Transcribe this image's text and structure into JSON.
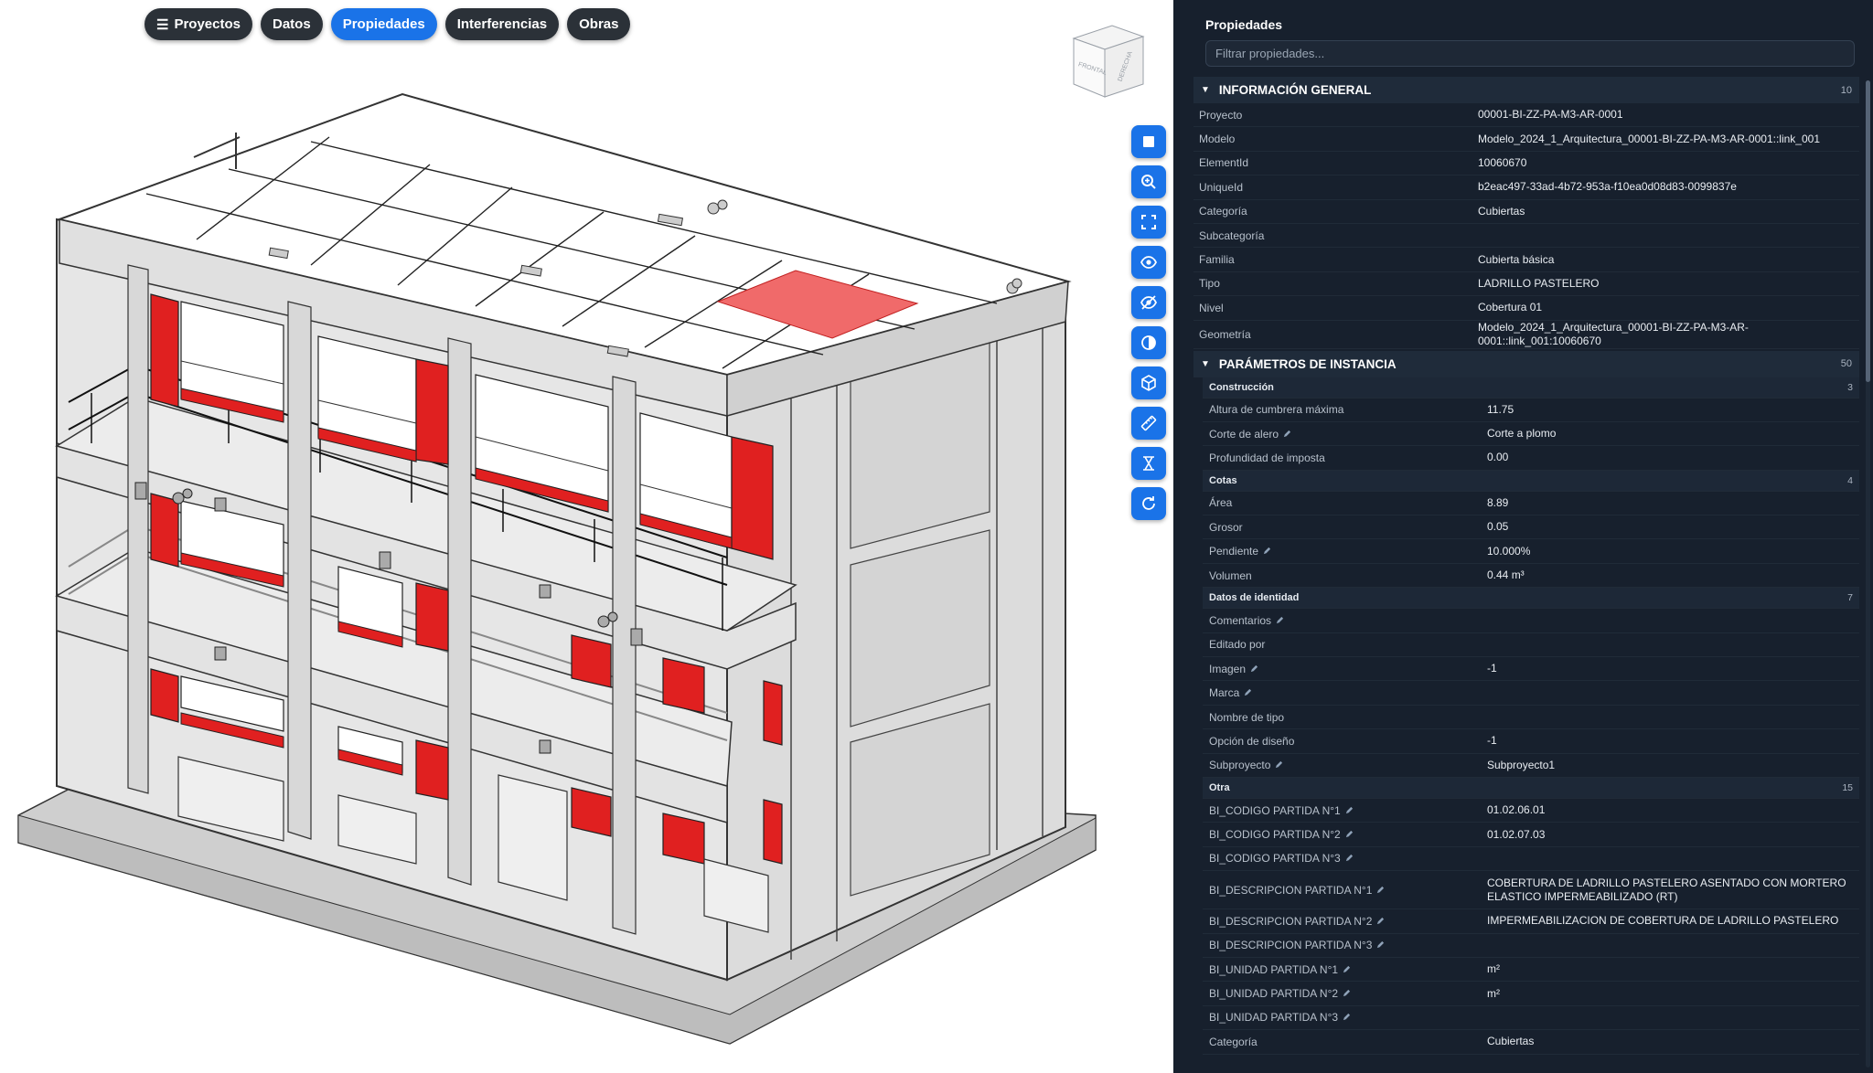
{
  "nav": {
    "items": [
      {
        "label": "Proyectos",
        "active": false,
        "icon": "menu-icon"
      },
      {
        "label": "Datos",
        "active": false
      },
      {
        "label": "Propiedades",
        "active": true
      },
      {
        "label": "Interferencias",
        "active": false
      },
      {
        "label": "Obras",
        "active": false
      }
    ]
  },
  "viewcube": {
    "front_label": "FRONTAL",
    "right_label": "DERECHA"
  },
  "toolbar": {
    "buttons": [
      {
        "icon": "square-view-icon"
      },
      {
        "icon": "zoom-icon"
      },
      {
        "icon": "fit-view-icon"
      },
      {
        "icon": "show-icon"
      },
      {
        "icon": "hide-icon"
      },
      {
        "icon": "contrast-icon"
      },
      {
        "icon": "cube-icon"
      },
      {
        "icon": "measure-icon"
      },
      {
        "icon": "section-icon"
      },
      {
        "icon": "reset-icon"
      }
    ]
  },
  "colors": {
    "accent": "#1a73e8",
    "panel_bg": "#17202d",
    "highlight": "#e02020"
  },
  "panel": {
    "title": "Propiedades",
    "filter_placeholder": "Filtrar propiedades...",
    "general": {
      "title": "INFORMACIÓN GENERAL",
      "count": "10",
      "rows": [
        {
          "k": "Proyecto",
          "v": "00001-BI-ZZ-PA-M3-AR-0001"
        },
        {
          "k": "Modelo",
          "v": "Modelo_2024_1_Arquitectura_00001-BI-ZZ-PA-M3-AR-0001::link_001"
        },
        {
          "k": "ElementId",
          "v": "10060670"
        },
        {
          "k": "UniqueId",
          "v": "b2eac497-33ad-4b72-953a-f10ea0d08d83-0099837e"
        },
        {
          "k": "Categoría",
          "v": "Cubiertas"
        },
        {
          "k": "Subcategoría",
          "v": ""
        },
        {
          "k": "Familia",
          "v": "Cubierta básica"
        },
        {
          "k": "Tipo",
          "v": "LADRILLO PASTELERO"
        },
        {
          "k": "Nivel",
          "v": "Cobertura 01"
        },
        {
          "k": "Geometría",
          "v": "Modelo_2024_1_Arquitectura_00001-BI-ZZ-PA-M3-AR-0001::link_001:10060670"
        }
      ]
    },
    "instance": {
      "title": "PARÁMETROS DE INSTANCIA",
      "count": "50",
      "groups": [
        {
          "title": "Construcción",
          "count": "3",
          "rows": [
            {
              "k": "Altura de cumbrera máxima",
              "v": "11.75",
              "edit": false
            },
            {
              "k": "Corte de alero",
              "v": "Corte a plomo",
              "edit": true
            },
            {
              "k": "Profundidad de imposta",
              "v": "0.00",
              "edit": false
            }
          ]
        },
        {
          "title": "Cotas",
          "count": "4",
          "rows": [
            {
              "k": "Área",
              "v": "8.89",
              "edit": false
            },
            {
              "k": "Grosor",
              "v": "0.05",
              "edit": false
            },
            {
              "k": "Pendiente",
              "v": "10.000%",
              "edit": true
            },
            {
              "k": "Volumen",
              "v": "0.44 m³",
              "edit": false
            }
          ]
        },
        {
          "title": "Datos de identidad",
          "count": "7",
          "rows": [
            {
              "k": "Comentarios",
              "v": "",
              "edit": true
            },
            {
              "k": "Editado por",
              "v": "",
              "edit": false
            },
            {
              "k": "Imagen",
              "v": "-1",
              "edit": true
            },
            {
              "k": "Marca",
              "v": "",
              "edit": true
            },
            {
              "k": "Nombre de tipo",
              "v": "",
              "edit": false
            },
            {
              "k": "Opción de diseño",
              "v": "-1",
              "edit": false
            },
            {
              "k": "Subproyecto",
              "v": "Subproyecto1",
              "edit": true
            }
          ]
        },
        {
          "title": "Otra",
          "count": "15",
          "rows": [
            {
              "k": "BI_CODIGO PARTIDA N°1",
              "v": "01.02.06.01",
              "edit": true
            },
            {
              "k": "BI_CODIGO PARTIDA N°2",
              "v": "01.02.07.03",
              "edit": true
            },
            {
              "k": "BI_CODIGO PARTIDA N°3",
              "v": "",
              "edit": true
            },
            {
              "k": "BI_DESCRIPCION PARTIDA N°1",
              "v": "COBERTURA DE LADRILLO PASTELERO ASENTADO CON MORTERO ELASTICO IMPERMEABILIZADO (RT)",
              "edit": true,
              "tall": true
            },
            {
              "k": "BI_DESCRIPCION PARTIDA N°2",
              "v": "IMPERMEABILIZACION DE COBERTURA DE LADRILLO PASTELERO",
              "edit": true
            },
            {
              "k": "BI_DESCRIPCION PARTIDA N°3",
              "v": "",
              "edit": true
            },
            {
              "k": "BI_UNIDAD PARTIDA N°1",
              "v": "m²",
              "edit": true
            },
            {
              "k": "BI_UNIDAD PARTIDA N°2",
              "v": "m²",
              "edit": true
            },
            {
              "k": "BI_UNIDAD PARTIDA N°3",
              "v": "",
              "edit": true
            },
            {
              "k": "Categoría",
              "v": "Cubiertas",
              "edit": false
            }
          ]
        }
      ]
    }
  }
}
